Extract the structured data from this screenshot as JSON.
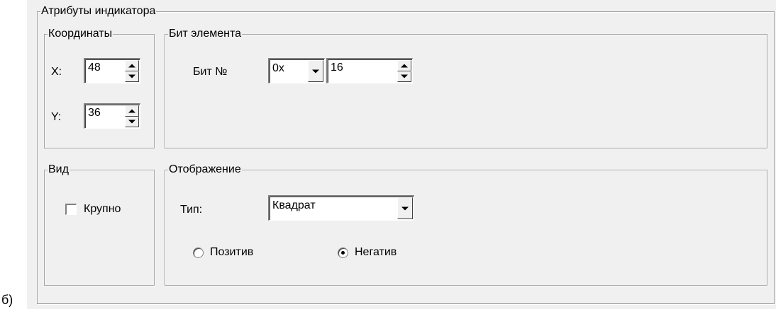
{
  "figure_label": "б)",
  "indicator_attributes": {
    "title": "Атрибуты индикатора",
    "coordinates": {
      "title": "Координаты",
      "x_label": "X:",
      "x_value": "48",
      "y_label": "Y:",
      "y_value": "36"
    },
    "bit_element": {
      "title": "Бит элемента",
      "bit_label": "Бит №",
      "prefix_value": "0x",
      "bit_value": "16"
    },
    "view": {
      "title": "Вид",
      "large_label": "Крупно",
      "large_checked": false
    },
    "display": {
      "title": "Отображение",
      "type_label": "Тип:",
      "type_value": "Квадрат",
      "positive_label": "Позитив",
      "negative_label": "Негатив",
      "selected": "negative"
    }
  }
}
